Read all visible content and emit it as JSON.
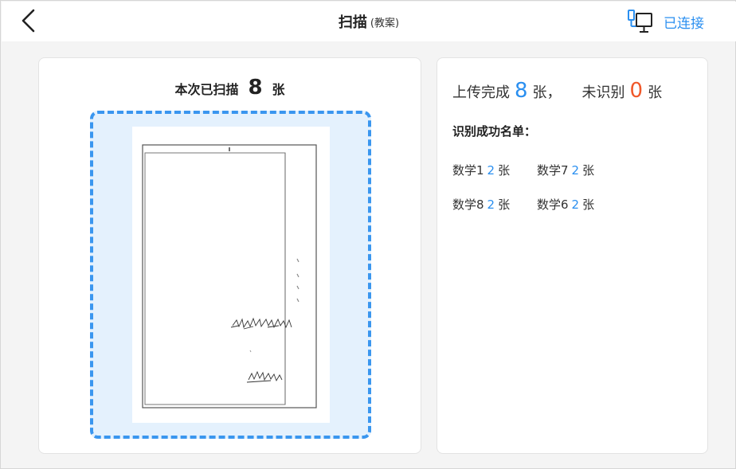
{
  "header": {
    "title": "扫描",
    "subtitle": "(教案)",
    "connection_label": "已连接",
    "accent_color": "#2a8ff0"
  },
  "scan": {
    "prefix": "本次已扫描",
    "count": "8",
    "unit": "张"
  },
  "summary": {
    "upload_prefix": "上传完成",
    "upload_count": "8",
    "upload_unit": "张，",
    "unrecognized_prefix": "未识别",
    "unrecognized_count": "0",
    "unrecognized_unit": "张",
    "list_title": "识别成功名单：",
    "items": [
      {
        "name": "数学1",
        "count": "2",
        "unit": "张"
      },
      {
        "name": "数学7",
        "count": "2",
        "unit": "张"
      },
      {
        "name": "数学8",
        "count": "2",
        "unit": "张"
      },
      {
        "name": "数学6",
        "count": "2",
        "unit": "张"
      }
    ]
  },
  "icons": {
    "back": "chevron-left-icon",
    "connection": "computer-connection-icon"
  },
  "colors": {
    "count_blue": "#2a8ff0",
    "count_red": "#f0582a",
    "scan_zone_bg": "#e4f1fd",
    "scan_zone_border": "#3a96ef"
  }
}
